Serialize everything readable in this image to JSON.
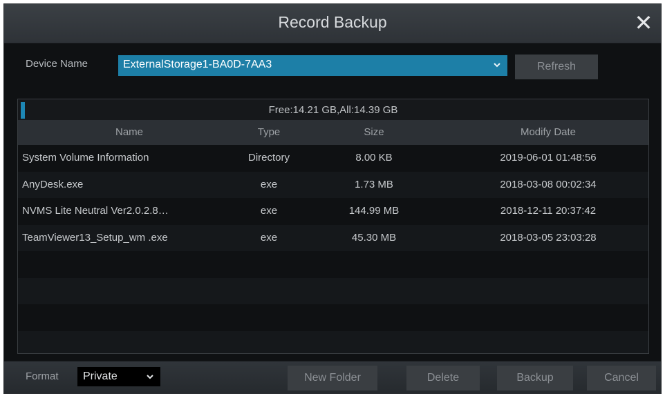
{
  "dialog": {
    "title": "Record Backup",
    "close_icon": "close-icon"
  },
  "device": {
    "label": "Device Name",
    "selected": "ExternalStorage1-BA0D-7AA3",
    "refresh_label": "Refresh"
  },
  "storage": {
    "capacity_text": "Free:14.21 GB,All:14.39 GB"
  },
  "table": {
    "headers": {
      "name": "Name",
      "type": "Type",
      "size": "Size",
      "date": "Modify Date"
    },
    "rows": [
      {
        "name": "System Volume Information",
        "type": "Directory",
        "size": "8.00 KB",
        "date": "2019-06-01 01:48:56"
      },
      {
        "name": "AnyDesk.exe",
        "type": "exe",
        "size": "1.73 MB",
        "date": "2018-03-08 00:02:34"
      },
      {
        "name": "NVMS Lite Neutral Ver2.0.2.8…",
        "type": "exe",
        "size": "144.99 MB",
        "date": "2018-12-11 20:37:42"
      },
      {
        "name": "TeamViewer13_Setup_wm .exe",
        "type": "exe",
        "size": "45.30 MB",
        "date": "2018-03-05 23:03:28"
      }
    ]
  },
  "footer": {
    "format_label": "Format",
    "format_value": "Private",
    "new_folder_label": "New Folder",
    "delete_label": "Delete",
    "backup_label": "Backup",
    "cancel_label": "Cancel"
  },
  "colors": {
    "accent": "#1d7fa7",
    "background": "#0f1113",
    "titlebar": "#33383d"
  }
}
